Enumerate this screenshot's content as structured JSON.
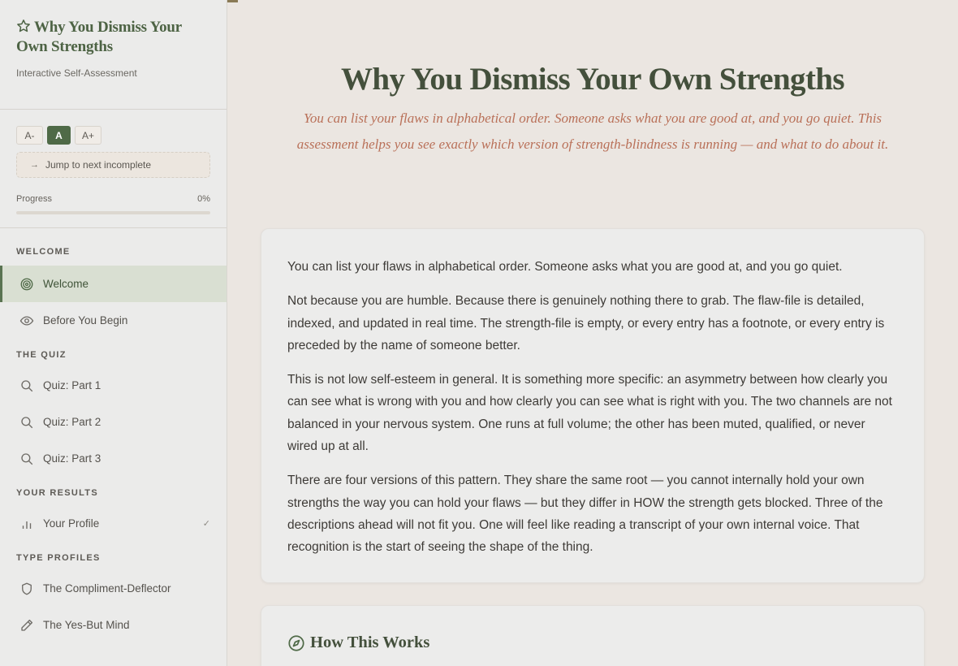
{
  "sidebar": {
    "brand_title": "Why You Dismiss Your Own Strengths",
    "brand_subtitle": "Interactive Self-Assessment",
    "font_controls": {
      "decrease": "A-",
      "normal": "A",
      "increase": "A+"
    },
    "jump_label": "Jump to next incomplete",
    "progress": {
      "label": "Progress",
      "value_text": "0%",
      "fraction": 0
    },
    "sections": [
      {
        "title": "WELCOME",
        "items": [
          {
            "label": "Welcome",
            "icon": "target-icon",
            "active": true
          },
          {
            "label": "Before You Begin",
            "icon": "eye-icon"
          }
        ]
      },
      {
        "title": "THE QUIZ",
        "items": [
          {
            "label": "Quiz: Part 1",
            "icon": "search-icon"
          },
          {
            "label": "Quiz: Part 2",
            "icon": "search-icon"
          },
          {
            "label": "Quiz: Part 3",
            "icon": "search-icon"
          }
        ]
      },
      {
        "title": "YOUR RESULTS",
        "items": [
          {
            "label": "Your Profile",
            "icon": "bar-chart-icon",
            "check": "✓"
          }
        ]
      },
      {
        "title": "TYPE PROFILES",
        "items": [
          {
            "label": "The Compliment-Deflector",
            "icon": "shield-icon"
          },
          {
            "label": "The Yes-But Mind",
            "icon": "pencil-icon"
          }
        ]
      }
    ]
  },
  "main": {
    "title": "Why You Dismiss Your Own Strengths",
    "subtitle": "You can list your flaws in alphabetical order. Someone asks what you are good at, and you go quiet. This assessment helps you see exactly which version of strength-blindness is running — and what to do about it.",
    "intro_paragraphs": [
      "You can list your flaws in alphabetical order. Someone asks what you are good at, and you go quiet.",
      "Not because you are humble. Because there is genuinely nothing there to grab. The flaw-file is detailed, indexed, and updated in real time. The strength-file is empty, or every entry has a footnote, or every entry is preceded by the name of someone better.",
      "This is not low self-esteem in general. It is something more specific: an asymmetry between how clearly you can see what is wrong with you and how clearly you can see what is right with you. The two channels are not balanced in your nervous system. One runs at full volume; the other has been muted, qualified, or never wired up at all.",
      "There are four versions of this pattern. They share the same root — you cannot internally hold your own strengths the way you can hold your flaws — but they differ in HOW the strength gets blocked. Three of the descriptions ahead will not fit you. One will feel like reading a transcript of your own internal voice. That recognition is the start of seeing the shape of the thing."
    ],
    "how_title": "How This Works"
  },
  "colors": {
    "accent_green": "#4f6a47",
    "title_green": "#44503c",
    "subtitle_terracotta": "#b97058",
    "background": "#ebe6e1"
  }
}
